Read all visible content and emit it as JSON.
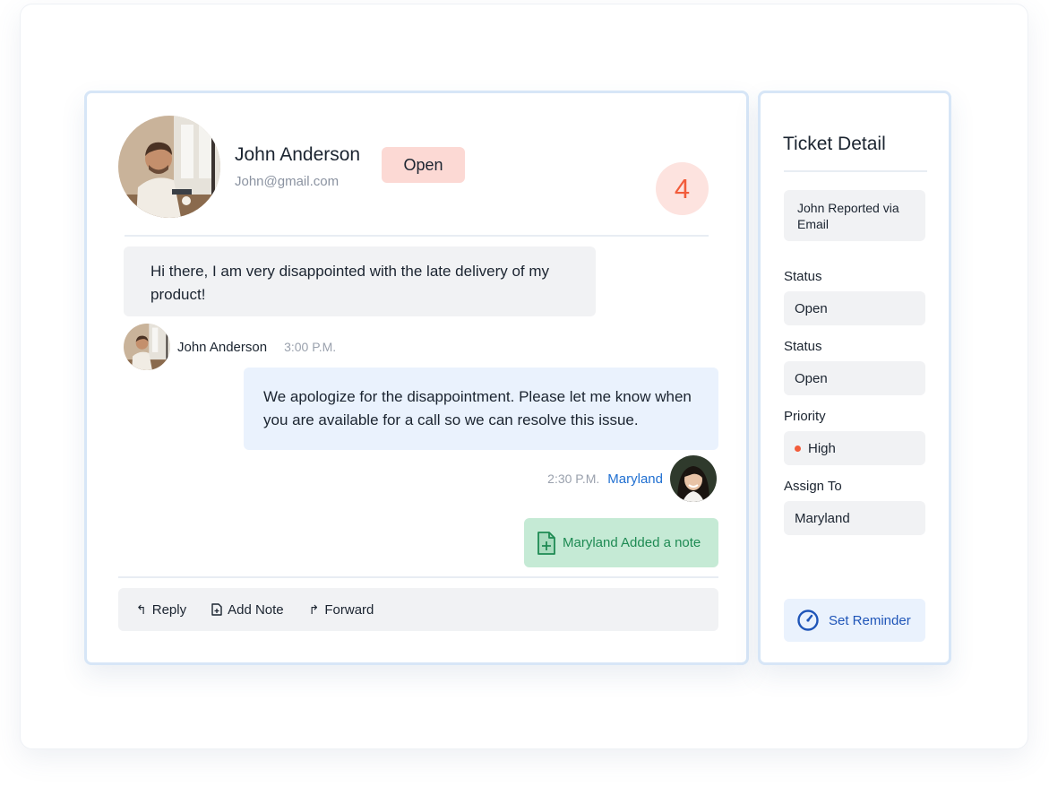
{
  "customer": {
    "name": "John Anderson",
    "email": "John@gmail.com",
    "status": "Open",
    "count": "4"
  },
  "messages": {
    "incoming": {
      "text": "Hi there, I am very disappointed with the late delivery of my product!",
      "sender": "John Anderson",
      "time": "3:00 P.M."
    },
    "outgoing": {
      "text": "We apologize for the disappointment. Please let me know when you are available for a call so we can resolve this issue.",
      "sender": "Maryland",
      "time": "2:30 P.M."
    },
    "note": "Maryland Added a note"
  },
  "actions": {
    "reply": "Reply",
    "add_note": "Add Note",
    "forward": "Forward"
  },
  "ticket": {
    "title": "Ticket Detail",
    "reported": "John Reported via Email",
    "fields": [
      {
        "label": "Status",
        "value": "Open"
      },
      {
        "label": "Status",
        "value": "Open"
      },
      {
        "label": "Priority",
        "value": "High"
      },
      {
        "label": "Assign To",
        "value": "Maryland"
      }
    ],
    "reminder": "Set Reminder"
  },
  "icons": {
    "reply": "reply-arrow-icon",
    "add_note": "document-icon",
    "forward": "forward-arrow-icon",
    "reminder": "clock-icon",
    "note": "add-document-icon"
  },
  "colors": {
    "accent_blue": "#1f6fd1",
    "status_pill": "#fcd9d4",
    "badge_text": "#f25c3b",
    "note_green": "#1e8a53",
    "panel_border": "#d7e6f7"
  }
}
